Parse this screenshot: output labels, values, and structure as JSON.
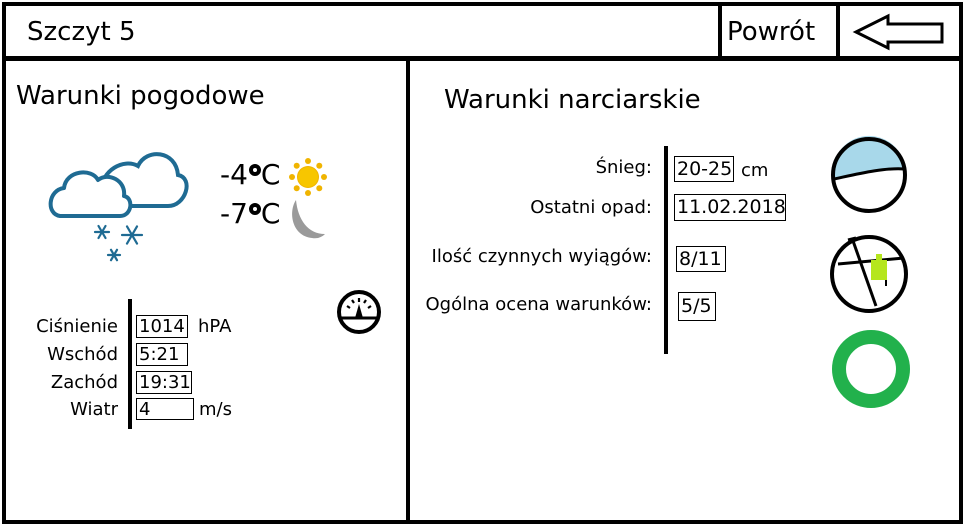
{
  "header": {
    "title": "Szczyt 5",
    "back_label": "Powrót",
    "back_icon": "arrow-left-icon"
  },
  "weather": {
    "heading": "Warunki pogodowe",
    "icon": "cloud-snow-icon",
    "temp_day": "-4",
    "temp_night": "-7",
    "temp_unit": "C",
    "day_icon": "sun-icon",
    "night_icon": "moon-icon",
    "gauge_icon": "gauge-icon",
    "rows": [
      {
        "label": "Ciśnienie",
        "value": "1014",
        "unit": "hPA"
      },
      {
        "label": "Wschód",
        "value": "5:21",
        "unit": ""
      },
      {
        "label": "Zachód",
        "value": "19:31",
        "unit": ""
      },
      {
        "label": "Wiatr",
        "value": "4",
        "unit": "m/s"
      }
    ]
  },
  "ski": {
    "heading": "Warunki narciarskie",
    "rows": [
      {
        "label": "Śnieg:",
        "value": "20-25",
        "unit": "cm"
      },
      {
        "label": "Ostatni opad:",
        "value": "11.02.2018",
        "unit": ""
      },
      {
        "label": "Ilość czynnych wyiągów:",
        "value": "8/11",
        "unit": ""
      },
      {
        "label": "Ogólna ocena warunków:",
        "value": "5/5",
        "unit": ""
      }
    ],
    "icons": [
      "snow-depth-icon",
      "ski-lift-icon",
      "rating-ring-icon"
    ],
    "colors": {
      "snow": "#a8d8ea",
      "lift_flag": "#b5e61d",
      "rating": "#22b14c"
    }
  }
}
